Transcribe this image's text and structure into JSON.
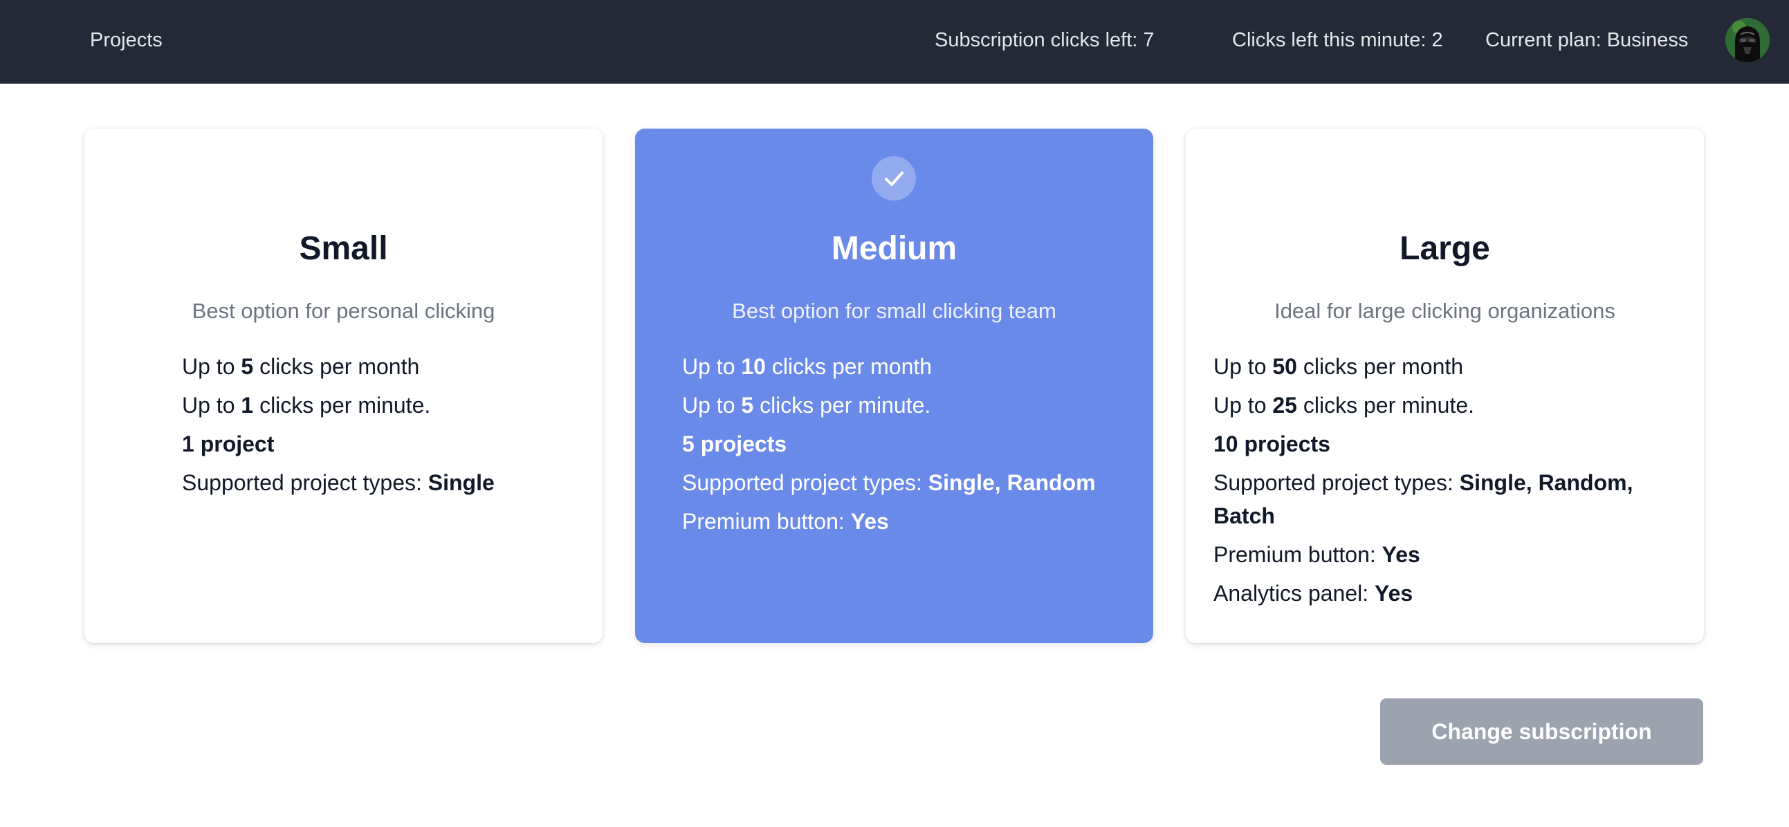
{
  "navbar": {
    "projects_label": "Projects",
    "subscription_clicks": "Subscription clicks left: 7",
    "clicks_minute": "Clicks left this minute: 2",
    "current_plan": "Current plan: Business",
    "avatar_icon": "darth-vader-avatar"
  },
  "plans": [
    {
      "title": "Small",
      "description": "Best option for personal clicking",
      "selected": false,
      "features": [
        {
          "pre": "Up to ",
          "bold": "5",
          "post": " clicks per month"
        },
        {
          "pre": "Up to ",
          "bold": "1",
          "post": " clicks per minute."
        },
        {
          "pre": "",
          "bold": "1 project",
          "post": ""
        },
        {
          "pre": "Supported project types: ",
          "bold": "Single",
          "post": ""
        }
      ]
    },
    {
      "title": "Medium",
      "description": "Best option for small clicking team",
      "selected": true,
      "features": [
        {
          "pre": "Up to ",
          "bold": "10",
          "post": " clicks per month"
        },
        {
          "pre": "Up to ",
          "bold": "5",
          "post": " clicks per minute."
        },
        {
          "pre": "",
          "bold": "5 projects",
          "post": ""
        },
        {
          "pre": "Supported project types: ",
          "bold": "Single, Random",
          "post": ""
        },
        {
          "pre": "Premium button: ",
          "bold": "Yes",
          "post": ""
        }
      ]
    },
    {
      "title": "Large",
      "description": "Ideal for large clicking organizations",
      "selected": false,
      "features": [
        {
          "pre": "Up to ",
          "bold": "50",
          "post": " clicks per month"
        },
        {
          "pre": "Up to ",
          "bold": "25",
          "post": " clicks per minute."
        },
        {
          "pre": "",
          "bold": "10 projects",
          "post": ""
        },
        {
          "pre": "Supported project types: ",
          "bold": "Single, Random, Batch",
          "post": ""
        },
        {
          "pre": "Premium button: ",
          "bold": "Yes",
          "post": ""
        },
        {
          "pre": "Analytics panel: ",
          "bold": "Yes",
          "post": ""
        }
      ]
    }
  ],
  "change_button_label": "Change subscription",
  "colors": {
    "navbar_bg": "#232937",
    "selected_card": "#6a8ae9",
    "button_disabled": "#9ca3af"
  }
}
